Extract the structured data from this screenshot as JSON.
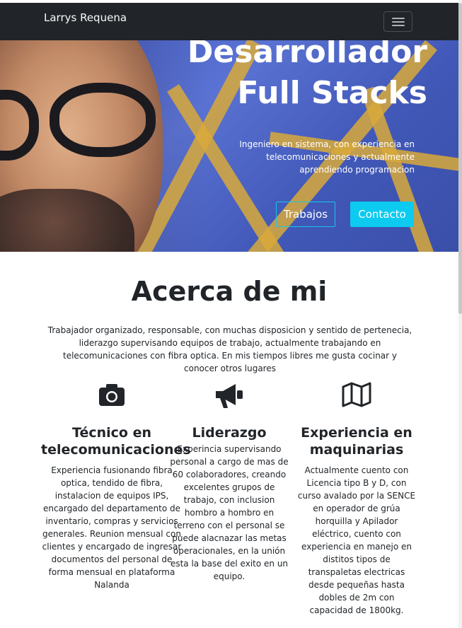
{
  "navbar": {
    "brand": "Larrys Requena",
    "toggle_icon": "hamburger-menu-icon"
  },
  "hero": {
    "title_line1": "Desarrollador",
    "title_line2": "Full Stacks",
    "subtitle": "Ingeniero en sistema, con experiencia en telecomunicaciones y actualmente aprendiendo programacion",
    "buttons": [
      {
        "label": "Trabajos"
      },
      {
        "label": "Contacto"
      }
    ]
  },
  "about": {
    "title": "Acerca de mi",
    "description": "Trabajador organizado, responsable, con muchas disposicion y sentido de pertenecia, liderazgo supervisando equipos de trabajo, actualmente trabajando en telecomunicaciones con fibra optica. En mis tiempos libres me gusta cocinar y conocer otros lugares",
    "features": [
      {
        "icon": "camera-icon",
        "title": "Técnico en telecomunicaciones",
        "text": "Experiencia fusionando fibra optica, tendido de fibra, instalacion de equipos IPS, encargado del departamento de inventario, compras y servicios generales. Reunion mensual con clientes y encargado de ingresar documentos del personal de forma mensual en plataforma Nalanda"
      },
      {
        "icon": "megaphone-icon",
        "title": "Liderazgo",
        "text": "Experincia supervisando personal a cargo de mas de 60 colaboradores, creando excelentes grupos de trabajo, con inclusion hombro a hombro en terreno con el personal se puede alacnazar las metas operacionales, en la unión esta la base del exito en un equipo."
      },
      {
        "icon": "map-icon",
        "title": "Experiencia en maquinarias",
        "text": "Actualmente cuento con Licencia tipo B y D, con curso avalado por la SENCE en operador de grúa horquilla y Apilador eléctrico, cuento con experiencia en manejo en distitos tipos de transpaletas electricas desde pequeñas hasta dobles de 2m con capacidad de 1800kg."
      }
    ]
  },
  "colors": {
    "navbar": "#212529",
    "accent": "#0dcaf0",
    "text": "#212529"
  }
}
